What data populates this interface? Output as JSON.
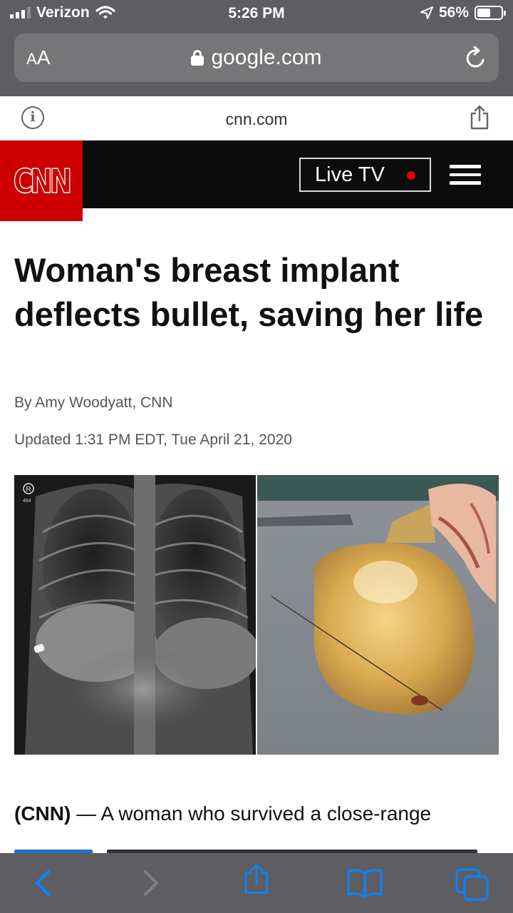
{
  "status_bar": {
    "carrier": "Verizon",
    "time": "5:26 PM",
    "battery": "56%",
    "battery_level": 0.56
  },
  "address_bar": {
    "text_size_label_small": "A",
    "text_size_label_large": "A",
    "url": "google.com"
  },
  "site_info": {
    "domain": "cnn.com"
  },
  "cnn_header": {
    "logo_text": "CNN",
    "live_tv_label": "Live TV",
    "live_dot_color": "#e60000",
    "brand_color": "#cc0000"
  },
  "article": {
    "headline": "Woman's breast implant deflects bullet, saving her life",
    "byline": "By Amy Woodyatt, CNN",
    "updated": "Updated 1:31 PM EDT, Tue April 21, 2020",
    "xray_marker": "R",
    "xray_code": "464",
    "lead_source": "(CNN)",
    "lead_text": " — A woman who survived a close-range"
  },
  "toolbar": {
    "icons": [
      "back-icon",
      "forward-icon",
      "share-icon",
      "bookmarks-icon",
      "tabs-icon"
    ],
    "accent_color": "#0a84ff"
  }
}
